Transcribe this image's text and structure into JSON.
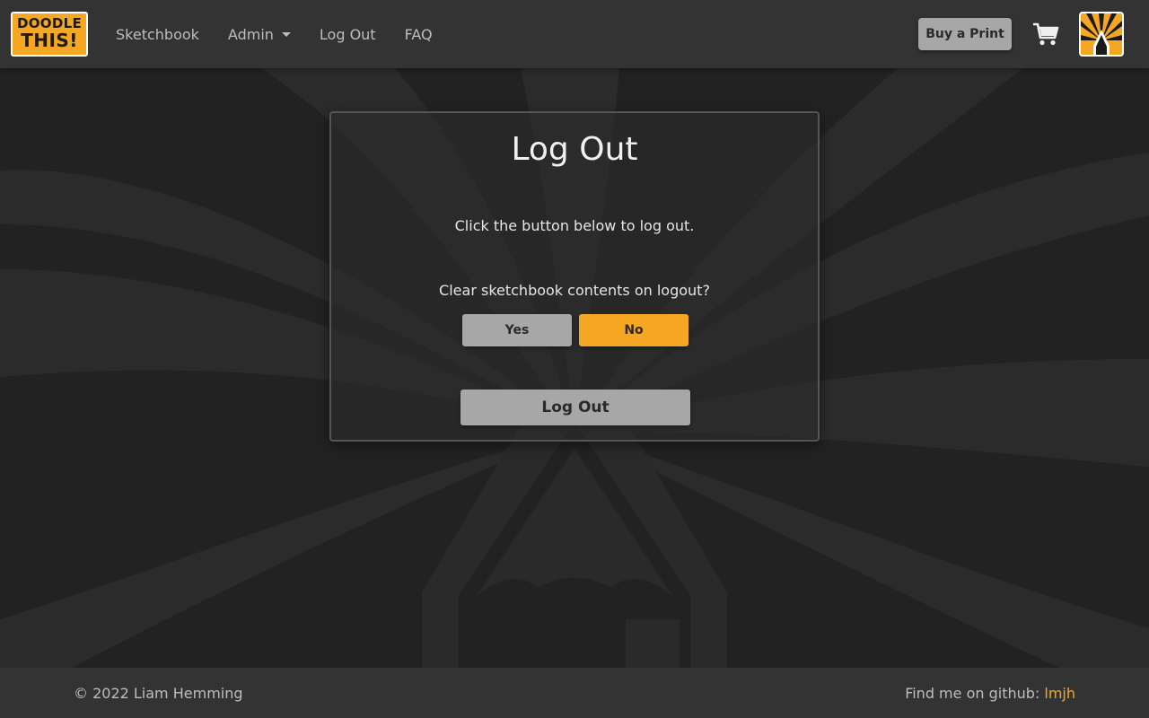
{
  "colors": {
    "background": "#222222",
    "navbar": "#333333",
    "accent": "#f5a623",
    "button_grey": "#a7a7a7"
  },
  "navbar": {
    "logo": {
      "line1": "DOODLE",
      "line2": "THIS!"
    },
    "links": [
      {
        "label": "Sketchbook"
      },
      {
        "label": "Admin",
        "dropdown": true
      },
      {
        "label": "Log Out"
      },
      {
        "label": "FAQ"
      }
    ],
    "buy_print_label": "Buy a Print",
    "cart_icon": "shopping-cart-icon",
    "avatar_icon": "pencil-sunburst-avatar"
  },
  "card": {
    "title": "Log Out",
    "instruction": "Click the button below to log out.",
    "question": "Clear sketchbook contents on logout?",
    "yes_label": "Yes",
    "no_label": "No",
    "selected_option": "No",
    "logout_label": "Log Out"
  },
  "footer": {
    "copyright": "© 2022 Liam Hemming",
    "github_prefix": "Find me on github: ",
    "github_link": "lmjh"
  }
}
